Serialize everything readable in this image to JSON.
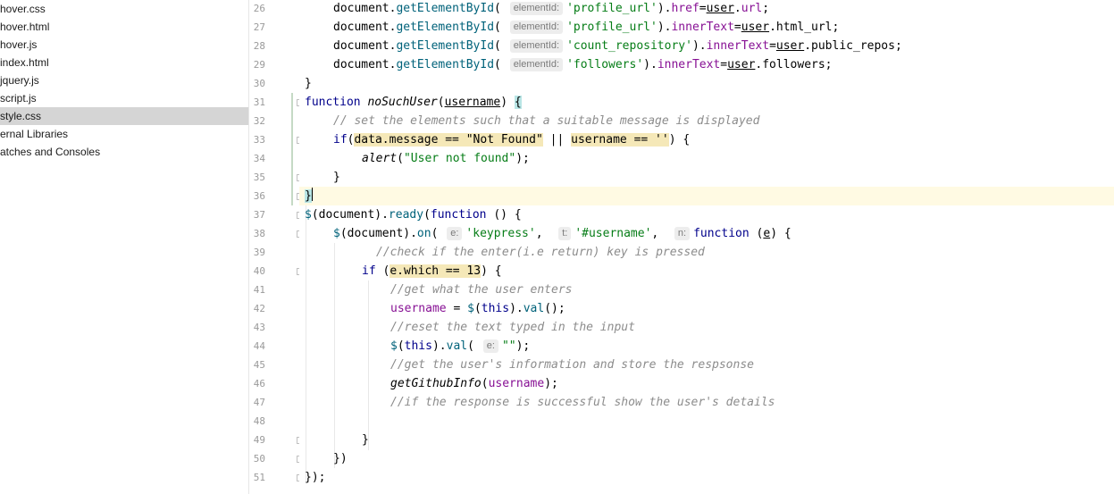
{
  "project_tree": [
    {
      "label": "hover.css",
      "selected": false
    },
    {
      "label": "hover.html",
      "selected": false
    },
    {
      "label": "hover.js",
      "selected": false
    },
    {
      "label": "index.html",
      "selected": false
    },
    {
      "label": "jquery.js",
      "selected": false
    },
    {
      "label": "script.js",
      "selected": false
    },
    {
      "label": "style.css",
      "selected": true
    },
    {
      "label": "ernal Libraries",
      "selected": false
    },
    {
      "label": "atches and Consoles",
      "selected": false
    }
  ],
  "editor": {
    "current_line": 36,
    "lines": [
      {
        "n": "26",
        "indent": 1,
        "fold": false,
        "segs": [
          {
            "t": "document.",
            "c": ""
          },
          {
            "t": "getElementById",
            "c": "fn"
          },
          {
            "t": "( ",
            "c": ""
          },
          {
            "hint": "elementId:"
          },
          {
            "t": "'profile_url'",
            "c": "str"
          },
          {
            "t": ").",
            "c": ""
          },
          {
            "t": "href",
            "c": "prop"
          },
          {
            "t": "=",
            "c": ""
          },
          {
            "t": "user",
            "c": "ul"
          },
          {
            "t": ".",
            "c": ""
          },
          {
            "t": "url",
            "c": "prop"
          },
          {
            "t": ";",
            "c": ""
          }
        ]
      },
      {
        "n": "27",
        "indent": 1,
        "fold": false,
        "segs": [
          {
            "t": "document.",
            "c": ""
          },
          {
            "t": "getElementById",
            "c": "fn"
          },
          {
            "t": "( ",
            "c": ""
          },
          {
            "hint": "elementId:"
          },
          {
            "t": "'profile_url'",
            "c": "str"
          },
          {
            "t": ").",
            "c": ""
          },
          {
            "t": "innerText",
            "c": "prop"
          },
          {
            "t": "=",
            "c": ""
          },
          {
            "t": "user",
            "c": "ul"
          },
          {
            "t": ".html_url;",
            "c": ""
          }
        ]
      },
      {
        "n": "28",
        "indent": 1,
        "fold": false,
        "segs": [
          {
            "t": "document.",
            "c": ""
          },
          {
            "t": "getElementById",
            "c": "fn"
          },
          {
            "t": "( ",
            "c": ""
          },
          {
            "hint": "elementId:"
          },
          {
            "t": "'count_repository'",
            "c": "str"
          },
          {
            "t": ").",
            "c": ""
          },
          {
            "t": "innerText",
            "c": "prop"
          },
          {
            "t": "=",
            "c": ""
          },
          {
            "t": "user",
            "c": "ul"
          },
          {
            "t": ".public_repos;",
            "c": ""
          }
        ]
      },
      {
        "n": "29",
        "indent": 1,
        "fold": false,
        "segs": [
          {
            "t": "document.",
            "c": ""
          },
          {
            "t": "getElementById",
            "c": "fn"
          },
          {
            "t": "( ",
            "c": ""
          },
          {
            "hint": "elementId:"
          },
          {
            "t": "'followers'",
            "c": "str"
          },
          {
            "t": ").",
            "c": ""
          },
          {
            "t": "innerText",
            "c": "prop"
          },
          {
            "t": "=",
            "c": ""
          },
          {
            "t": "user",
            "c": "ul"
          },
          {
            "t": ".followers;",
            "c": ""
          }
        ]
      },
      {
        "n": "30",
        "indent": 0,
        "fold": false,
        "segs": [
          {
            "t": "}",
            "c": ""
          }
        ]
      },
      {
        "n": "31",
        "indent": 0,
        "fold": true,
        "segs": [
          {
            "t": "function ",
            "c": "kw"
          },
          {
            "t": "noSuchUser",
            "c": "it"
          },
          {
            "t": "(",
            "c": ""
          },
          {
            "t": "username",
            "c": "ul"
          },
          {
            "t": ") ",
            "c": ""
          },
          {
            "t": "{",
            "c": "brace"
          }
        ]
      },
      {
        "n": "32",
        "indent": 1,
        "fold": false,
        "segs": [
          {
            "t": "// set the elements such that a suitable message is displayed",
            "c": "cm"
          }
        ]
      },
      {
        "n": "33",
        "indent": 1,
        "fold": true,
        "segs": [
          {
            "t": "if",
            "c": "kw"
          },
          {
            "t": "(",
            "c": ""
          },
          {
            "t": "data.message == \"Not Found\"",
            "c": "hl"
          },
          {
            "t": " || ",
            "c": ""
          },
          {
            "t": "username == ''",
            "c": "hl"
          },
          {
            "t": ") {",
            "c": ""
          }
        ]
      },
      {
        "n": "34",
        "indent": 2,
        "fold": false,
        "segs": [
          {
            "t": "alert",
            "c": "it"
          },
          {
            "t": "(",
            "c": ""
          },
          {
            "t": "\"User not found\"",
            "c": "str"
          },
          {
            "t": ");",
            "c": ""
          }
        ]
      },
      {
        "n": "35",
        "indent": 1,
        "fold": true,
        "segs": [
          {
            "t": "}",
            "c": ""
          }
        ]
      },
      {
        "n": "36",
        "indent": 0,
        "fold": true,
        "segs": [
          {
            "t": "}",
            "c": "brace"
          },
          {
            "caret": true
          }
        ]
      },
      {
        "n": "37",
        "indent": 0,
        "fold": true,
        "segs": [
          {
            "t": "$",
            "c": "fn"
          },
          {
            "t": "(document).",
            "c": ""
          },
          {
            "t": "ready",
            "c": "fn"
          },
          {
            "t": "(",
            "c": ""
          },
          {
            "t": "function",
            "c": "kw"
          },
          {
            "t": " () {",
            "c": ""
          }
        ]
      },
      {
        "n": "38",
        "indent": 1,
        "fold": true,
        "segs": [
          {
            "t": "$",
            "c": "fn"
          },
          {
            "t": "(document).",
            "c": ""
          },
          {
            "t": "on",
            "c": "fn"
          },
          {
            "t": "( ",
            "c": ""
          },
          {
            "hint": "e:"
          },
          {
            "t": "'keypress'",
            "c": "str"
          },
          {
            "t": ",  ",
            "c": ""
          },
          {
            "hint": "t:"
          },
          {
            "t": "'#username'",
            "c": "str"
          },
          {
            "t": ",  ",
            "c": ""
          },
          {
            "hint": "n:"
          },
          {
            "t": "function",
            "c": "kw"
          },
          {
            "t": " (",
            "c": ""
          },
          {
            "t": "e",
            "c": "ul"
          },
          {
            "t": ") {",
            "c": ""
          }
        ]
      },
      {
        "n": "39",
        "indent": 2.5,
        "fold": false,
        "segs": [
          {
            "t": "//check if the enter(i.e return) key is pressed",
            "c": "cm"
          }
        ]
      },
      {
        "n": "40",
        "indent": 2,
        "fold": true,
        "segs": [
          {
            "t": "if",
            "c": "kw"
          },
          {
            "t": " (",
            "c": ""
          },
          {
            "t": "e.which == 13",
            "c": "hl"
          },
          {
            "t": ") {",
            "c": ""
          }
        ]
      },
      {
        "n": "41",
        "indent": 3,
        "fold": false,
        "segs": [
          {
            "t": "//get what the user enters",
            "c": "cm"
          }
        ]
      },
      {
        "n": "42",
        "indent": 3,
        "fold": false,
        "segs": [
          {
            "t": "username",
            "c": "prop"
          },
          {
            "t": " = ",
            "c": ""
          },
          {
            "t": "$",
            "c": "fn"
          },
          {
            "t": "(",
            "c": ""
          },
          {
            "t": "this",
            "c": "kw"
          },
          {
            "t": ").",
            "c": ""
          },
          {
            "t": "val",
            "c": "fn"
          },
          {
            "t": "();",
            "c": ""
          }
        ]
      },
      {
        "n": "43",
        "indent": 3,
        "fold": false,
        "segs": [
          {
            "t": "//reset the text typed in the input",
            "c": "cm"
          }
        ]
      },
      {
        "n": "44",
        "indent": 3,
        "fold": false,
        "segs": [
          {
            "t": "$",
            "c": "fn"
          },
          {
            "t": "(",
            "c": ""
          },
          {
            "t": "this",
            "c": "kw"
          },
          {
            "t": ").",
            "c": ""
          },
          {
            "t": "val",
            "c": "fn"
          },
          {
            "t": "( ",
            "c": ""
          },
          {
            "hint": "e:"
          },
          {
            "t": "\"\"",
            "c": "str"
          },
          {
            "t": ");",
            "c": ""
          }
        ]
      },
      {
        "n": "45",
        "indent": 3,
        "fold": false,
        "segs": [
          {
            "t": "//get the user's information and store the respsonse",
            "c": "cm"
          }
        ]
      },
      {
        "n": "46",
        "indent": 3,
        "fold": false,
        "segs": [
          {
            "t": "getGithubInfo",
            "c": "it"
          },
          {
            "t": "(",
            "c": ""
          },
          {
            "t": "username",
            "c": "prop"
          },
          {
            "t": ");",
            "c": ""
          }
        ]
      },
      {
        "n": "47",
        "indent": 3,
        "fold": false,
        "segs": [
          {
            "t": "//if the response is successful show the user's details",
            "c": "cm"
          }
        ]
      },
      {
        "n": "48",
        "indent": 0,
        "fold": false,
        "segs": []
      },
      {
        "n": "49",
        "indent": 2,
        "fold": true,
        "segs": [
          {
            "t": "}",
            "c": ""
          }
        ]
      },
      {
        "n": "50",
        "indent": 1,
        "fold": true,
        "segs": [
          {
            "t": "})",
            "c": ""
          }
        ]
      },
      {
        "n": "51",
        "indent": 0,
        "fold": true,
        "segs": [
          {
            "t": "});",
            "c": ""
          }
        ]
      }
    ]
  }
}
